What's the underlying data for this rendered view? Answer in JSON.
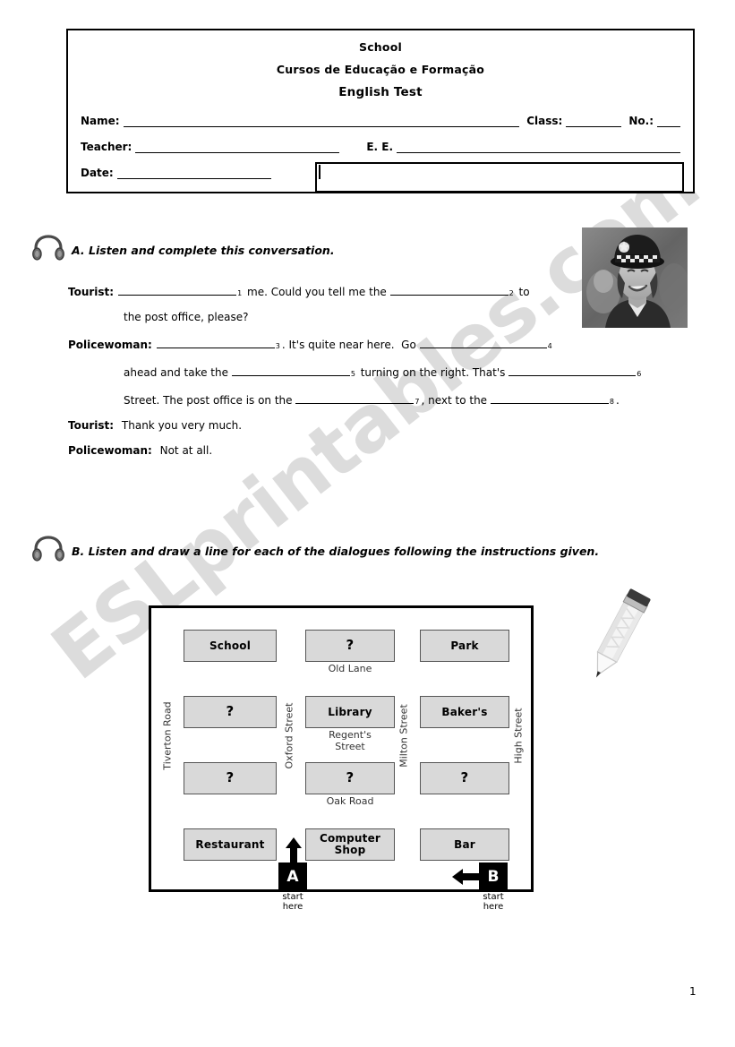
{
  "watermark": {
    "text": "ESLprintables.com"
  },
  "header": {
    "school_line": "School",
    "course_line": "Cursos de Educação e Formação",
    "test_line": "English Test",
    "name_label": "Name:",
    "class_label": "Class:",
    "number_label": "No.:",
    "teacher_label": "Teacher:",
    "ee_label": "E. E.",
    "date_label": "Date:",
    "name_value": "",
    "class_value": "",
    "number_value": "",
    "teacher_value": "",
    "ee_value": "",
    "date_value": "",
    "grade_value": ""
  },
  "section_a": {
    "icon": "headphones-icon",
    "heading": "A. Listen and complete this conversation.",
    "photo_alt": "policewoman-photo",
    "lines": [
      {
        "speaker": "Tourist:",
        "parts": [
          {
            "type": "blank",
            "num": "1",
            "size": "b-md"
          },
          {
            "type": "text",
            "value": " me. Could you tell me the "
          },
          {
            "type": "blank",
            "num": "2",
            "size": "b-md"
          },
          {
            "type": "text",
            "value": " to"
          }
        ]
      },
      {
        "speaker": "",
        "indent": true,
        "parts": [
          {
            "type": "text",
            "value": "the post office, please?"
          }
        ]
      },
      {
        "speaker": "Policewoman:",
        "parts": [
          {
            "type": "blank",
            "num": "3",
            "size": "b-md"
          },
          {
            "type": "text",
            "value": ". It's quite near here.  Go "
          },
          {
            "type": "blank",
            "num": "4",
            "size": "b-lg"
          }
        ]
      },
      {
        "speaker": "",
        "indent": true,
        "parts": [
          {
            "type": "text",
            "value": "ahead and take the "
          },
          {
            "type": "blank",
            "num": "5",
            "size": "b-md"
          },
          {
            "type": "text",
            "value": " turning on the right. That's "
          },
          {
            "type": "blank",
            "num": "6",
            "size": "b-lg"
          }
        ]
      },
      {
        "speaker": "",
        "indent": true,
        "parts": [
          {
            "type": "text",
            "value": "Street. The post office is on the "
          },
          {
            "type": "blank",
            "num": "7",
            "size": "b-md"
          },
          {
            "type": "text",
            "value": ", next to the "
          },
          {
            "type": "blank",
            "num": "8",
            "size": "b-md"
          },
          {
            "type": "text",
            "value": "."
          }
        ]
      },
      {
        "speaker": "Tourist:",
        "parts": [
          {
            "type": "text",
            "value": " Thank you very much."
          }
        ]
      },
      {
        "speaker": "Policewoman:",
        "parts": [
          {
            "type": "text",
            "value": " Not at all."
          }
        ]
      }
    ]
  },
  "section_b": {
    "icon": "headphones-icon",
    "heading": "B. Listen and draw a line for each of the dialogues following the instructions given.",
    "pencil_alt": "pencil-illustration",
    "map": {
      "buildings": [
        {
          "label": "School",
          "col": 0,
          "row": 0
        },
        {
          "label": "?",
          "col": 1,
          "row": 0
        },
        {
          "label": "Park",
          "col": 2,
          "row": 0
        },
        {
          "label": "?",
          "col": 0,
          "row": 1
        },
        {
          "label": "Library",
          "col": 1,
          "row": 1
        },
        {
          "label": "Baker's",
          "col": 2,
          "row": 1
        },
        {
          "label": "?",
          "col": 0,
          "row": 2
        },
        {
          "label": "?",
          "col": 1,
          "row": 2
        },
        {
          "label": "?",
          "col": 2,
          "row": 2
        },
        {
          "label": "Restaurant",
          "col": 0,
          "row": 3
        },
        {
          "label": "Computer\nShop",
          "col": 1,
          "row": 3
        },
        {
          "label": "Bar",
          "col": 2,
          "row": 3
        }
      ],
      "horizontal_streets": [
        {
          "name": "Old Lane"
        },
        {
          "name": "Regent's\nStreet"
        },
        {
          "name": "Oak Road"
        }
      ],
      "vertical_streets": [
        {
          "name": "Tiverton Road"
        },
        {
          "name": "Oxford Street"
        },
        {
          "name": "Milton Street"
        },
        {
          "name": "High Street"
        }
      ],
      "markers": [
        {
          "id": "A",
          "direction": "up",
          "caption": "start\nhere"
        },
        {
          "id": "B",
          "direction": "left",
          "caption": "start\nhere"
        }
      ]
    }
  },
  "footer": {
    "page_number": "1"
  }
}
